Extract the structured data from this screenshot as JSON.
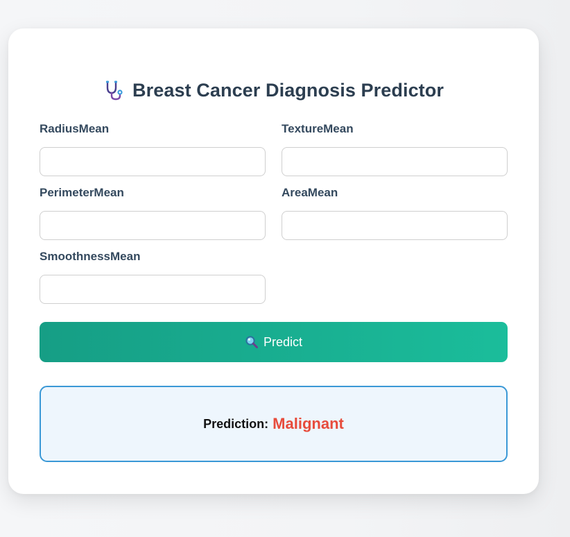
{
  "app": {
    "title": "Breast Cancer Diagnosis Predictor",
    "title_icon": "stethoscope-icon"
  },
  "form": {
    "fields": [
      {
        "label": "RadiusMean",
        "value": "",
        "placeholder": ""
      },
      {
        "label": "TextureMean",
        "value": "",
        "placeholder": ""
      },
      {
        "label": "PerimeterMean",
        "value": "",
        "placeholder": ""
      },
      {
        "label": "AreaMean",
        "value": "",
        "placeholder": ""
      },
      {
        "label": "SmoothnessMean",
        "value": "",
        "placeholder": ""
      }
    ],
    "submit": {
      "label": "Predict",
      "icon": "search-icon"
    }
  },
  "result": {
    "label": "Prediction:",
    "value": "Malignant",
    "value_color": "#e74c3c"
  },
  "colors": {
    "button_gradient_start": "#169e85",
    "button_gradient_end": "#1bbd9b",
    "result_border": "#3a98d6",
    "result_background": "#eef6fd",
    "heading_text": "#2c3e50"
  }
}
